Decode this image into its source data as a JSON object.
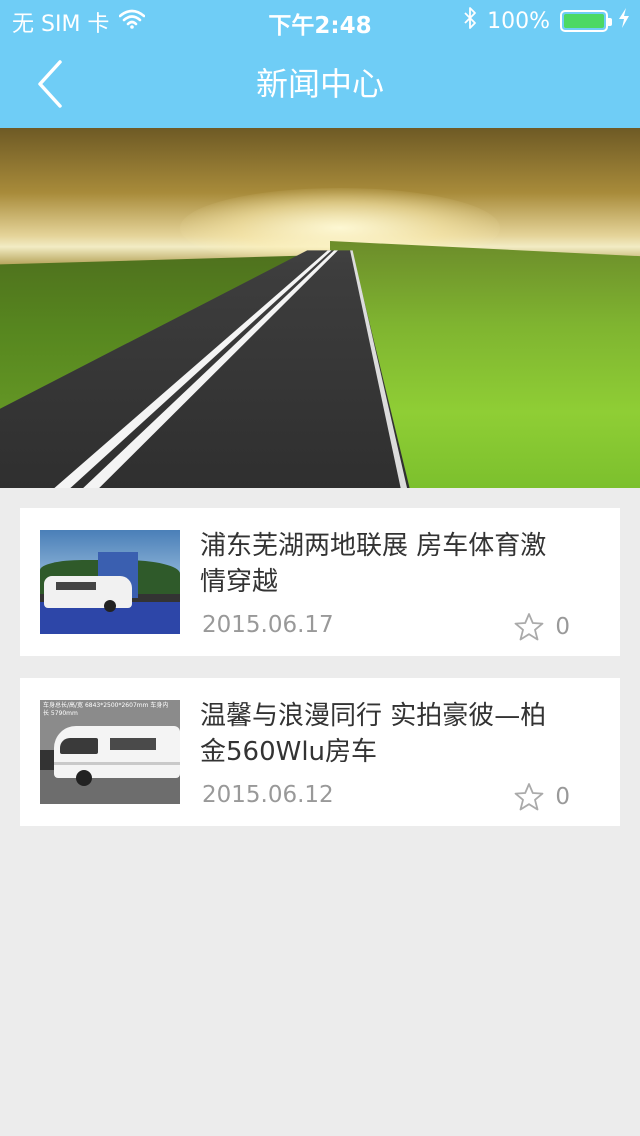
{
  "status_bar": {
    "carrier": "无 SIM 卡",
    "time": "下午2:48",
    "battery": "100%"
  },
  "nav": {
    "title": "新闻中心"
  },
  "news": [
    {
      "title": "浦东芜湖两地联展 房车体育激情穿越",
      "date": "2015.06.17",
      "favorites": "0"
    },
    {
      "title": "温馨与浪漫同行 实拍豪彼—柏金560Wlu房车",
      "date": "2015.06.12",
      "favorites": "0",
      "thumb_caption": "车身总长/高/宽 6843*2500*2607mm 车身内长 5790mm"
    }
  ],
  "colors": {
    "accent": "#6fcdf6",
    "battery": "#4cd964",
    "background": "#ececec"
  }
}
